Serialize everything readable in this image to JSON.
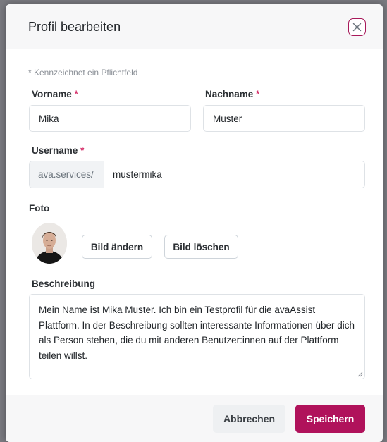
{
  "dialog": {
    "title": "Profil bearbeiten",
    "close_icon": "close-x-icon"
  },
  "form": {
    "required_note": "* Kennzeichnet ein Pflichtfeld",
    "required_marker": "*",
    "firstname": {
      "label": "Vorname",
      "value": "Mika"
    },
    "lastname": {
      "label": "Nachname",
      "value": "Muster"
    },
    "username": {
      "label": "Username",
      "prefix": "ava.services/",
      "value": "mustermika"
    },
    "photo": {
      "label": "Foto",
      "change_label": "Bild ändern",
      "delete_label": "Bild löschen"
    },
    "description": {
      "label": "Beschreibung",
      "value": "Mein Name ist Mika Muster. Ich bin ein Testprofil für die avaAssist Plattform. In der Beschreibung sollten interessante Informationen über dich als Person stehen, die du mit anderen Benutzer:innen auf der Plattform teilen willst."
    }
  },
  "footer": {
    "cancel_label": "Abbrechen",
    "save_label": "Speichern"
  },
  "colors": {
    "accent": "#b0125b",
    "required": "#d6336c"
  }
}
